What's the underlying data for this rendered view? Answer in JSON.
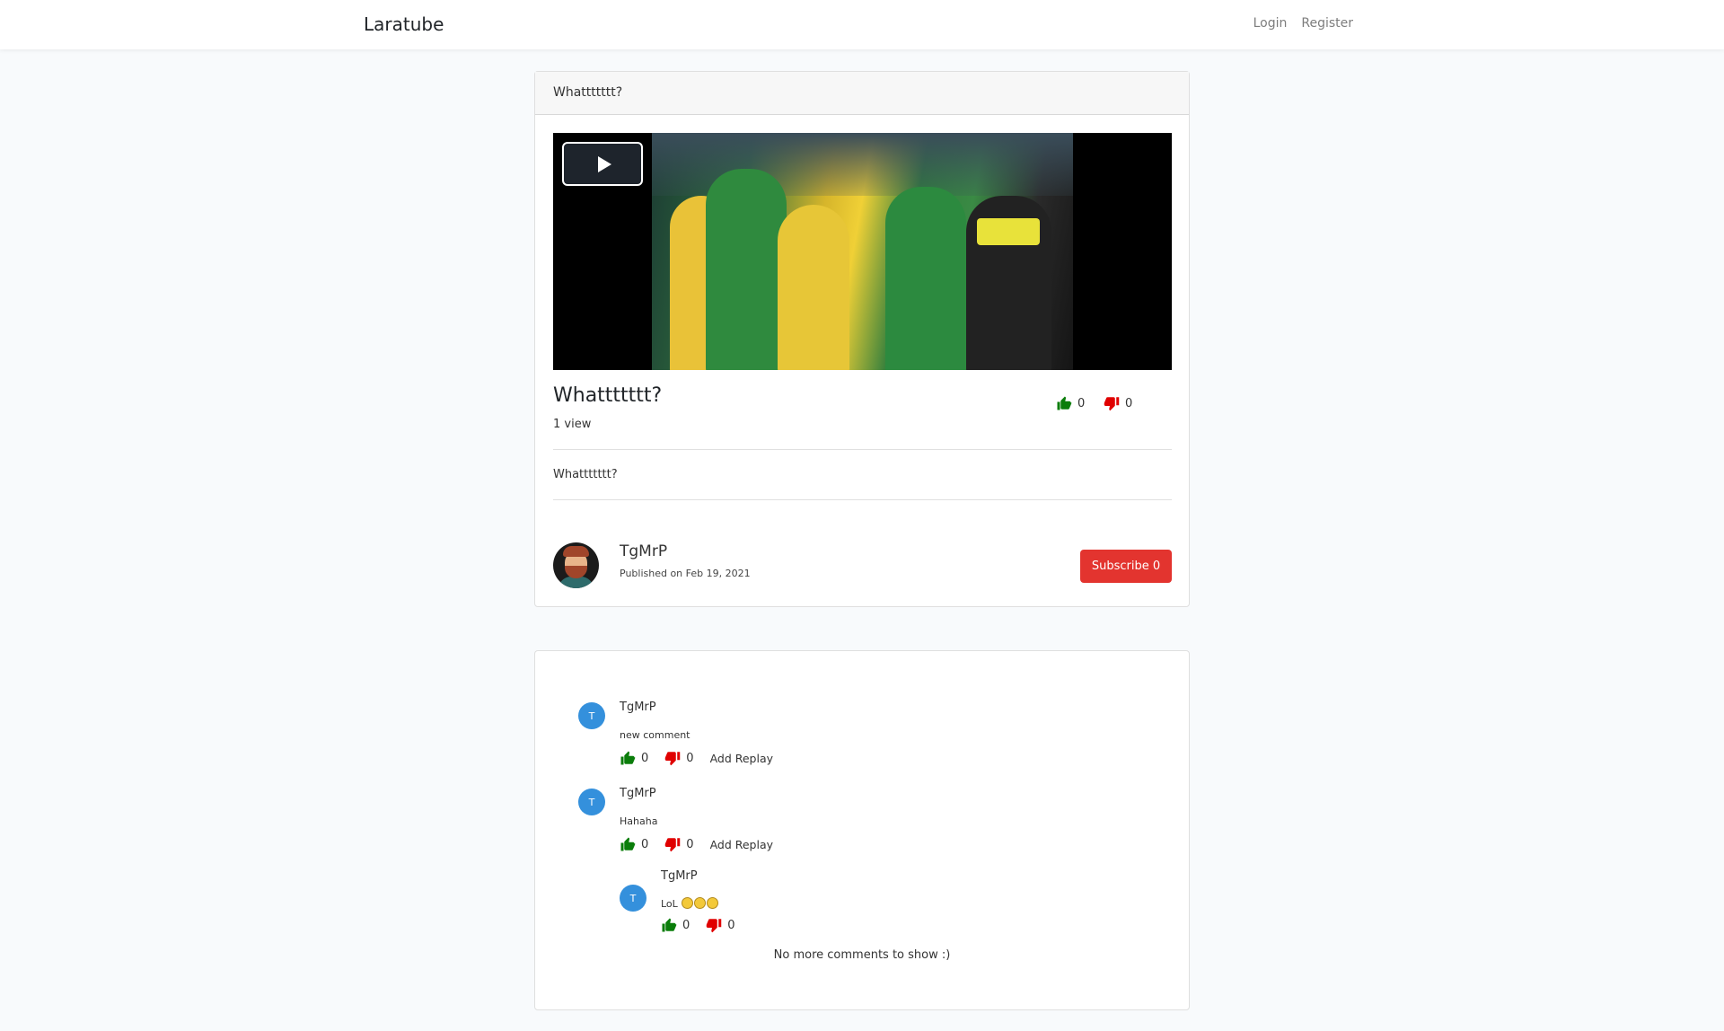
{
  "navbar": {
    "brand": "Laratube",
    "login_label": "Login",
    "register_label": "Register"
  },
  "video": {
    "header_title": "Whattttttt?",
    "title": "Whattttttt?",
    "views": "1 view",
    "likes": "0",
    "dislikes": "0",
    "description": "Whattttttt?",
    "channel_name": "TgMrP",
    "published": "Published on Feb 19, 2021",
    "subscribe_label": "Subscribe 0"
  },
  "comments": {
    "items": [
      {
        "avatar_letter": "T",
        "author": "TgMrP",
        "body": "new comment",
        "likes": "0",
        "dislikes": "0",
        "reply_label": "Add Replay"
      },
      {
        "avatar_letter": "T",
        "author": "TgMrP",
        "body": "Hahaha",
        "likes": "0",
        "dislikes": "0",
        "reply_label": "Add Replay"
      }
    ],
    "reply": {
      "avatar_letter": "T",
      "author": "TgMrP",
      "body": "LoL",
      "emoji_count": 3,
      "likes": "0",
      "dislikes": "0"
    },
    "footer": "No more comments to show :)"
  },
  "colors": {
    "like": "#0a7d0a",
    "dislike": "#e00000",
    "subscribe": "#e3342f",
    "comment_avatar": "#3490dc"
  }
}
